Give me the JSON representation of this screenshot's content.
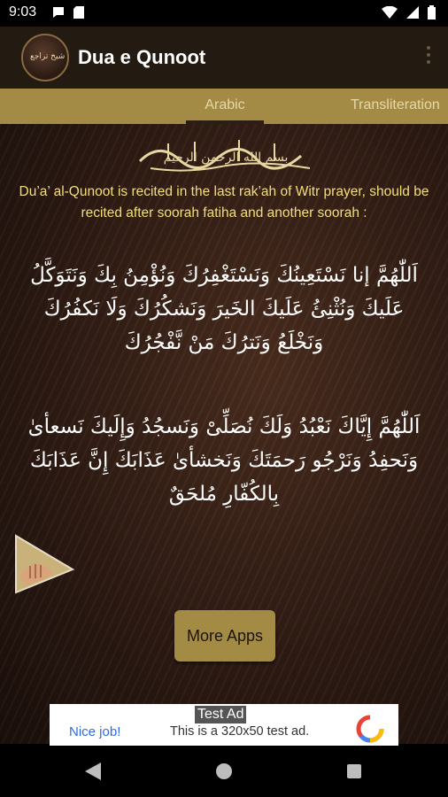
{
  "status_bar": {
    "time": "9:03"
  },
  "app_bar": {
    "title": "Dua e Qunoot",
    "logo_text": "شيخ تراجع"
  },
  "tabs": [
    {
      "label": "Arabic"
    },
    {
      "label": "Transliteration"
    }
  ],
  "content": {
    "bismillah": "بسم الله الرحمن الرحيم",
    "intro": "Du’a’ al-Qunoot is recited in the last rak’ah of Witr prayer, should be recited after soorah fatiha and another soorah :",
    "dua_paragraph_1": "اَللّٰهُمَّ إنا نَسْتَعِينُكَ وَنَسْتَغْفِرُكَ وَنُؤْمِنُ بِكَ وَنَتَوَكَّلُ عَلَيكَ وَنُثْنِئُ عَلَيكَ الخَيرَ وَنَشكُرُكَ وَلَا نَكفُرُكَ وَنَخْلَعُ وَنَترُكَ مَنْ نَّفْجُرُكَ",
    "dua_paragraph_2": "اَللّٰهُمَّ إِيَّاكَ نَعْبُدُ وَلَكَ نُصَلِّىْ وَنَسجُدُ وَإِلَيكَ نَسعأیٰ وَنَحفِدُ وَنَرْجُو رَحمَتَكَ وَنَخشأیٰ عَذَابَكَ إِنَّ عَذَابَكَ بِالكُفّارِ مُلحَقٌ",
    "more_apps_label": "More Apps"
  },
  "ad": {
    "label": "Test Ad",
    "nice": "Nice job!",
    "text": "This is a 320x50 test ad."
  },
  "colors": {
    "tab_bar": "#a38a45",
    "intro_text": "#f3df7a",
    "app_bar": "#231a12"
  }
}
